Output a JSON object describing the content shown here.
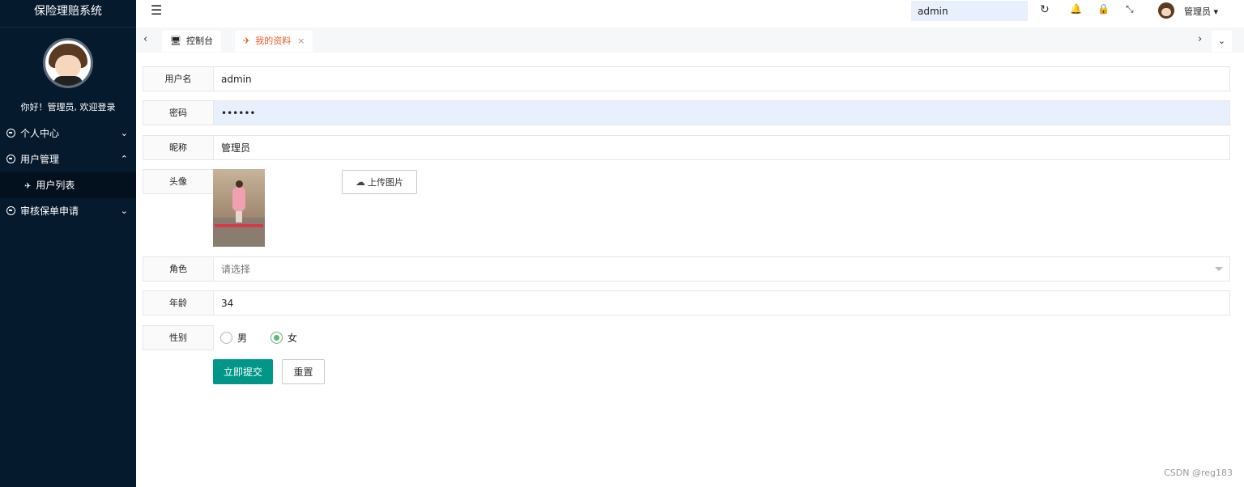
{
  "sidebar": {
    "title": "保险理赔系统",
    "welcome": "你好！管理员, 欢迎登录",
    "menu": [
      {
        "label": "个人中心",
        "chevron": "⌄"
      },
      {
        "label": "用户管理",
        "chevron": "⌃"
      },
      {
        "label": "审核保单申请",
        "chevron": "⌄"
      }
    ],
    "submenu": [
      {
        "label": "用户列表",
        "icon": "✈"
      }
    ]
  },
  "header": {
    "fold_icon": "☰",
    "search_value": "admin",
    "icons": {
      "refresh": "↻",
      "bell": "🔔",
      "lock": "🔒",
      "fullscreen": "⤡"
    },
    "user_name": "管理员 ▾"
  },
  "tabs": {
    "left_arrow": "‹",
    "right_arrow": "›",
    "dropdown": "⌄",
    "items": [
      {
        "label": "控制台",
        "icon": "🖥"
      },
      {
        "label": "我的资料",
        "icon": "✈",
        "close": "×",
        "active": true
      }
    ]
  },
  "form": {
    "username": {
      "label": "用户名",
      "value": "admin"
    },
    "password": {
      "label": "密码",
      "value": "••••••"
    },
    "nickname": {
      "label": "昵称",
      "value": "管理员"
    },
    "avatar": {
      "label": "头像",
      "upload_label": "上传图片",
      "upload_icon": "☁"
    },
    "role": {
      "label": "角色",
      "placeholder": "请选择"
    },
    "age": {
      "label": "年龄",
      "value": "34"
    },
    "gender": {
      "label": "性别",
      "options": [
        "男",
        "女"
      ],
      "selected": "女"
    },
    "submit_label": "立即提交",
    "reset_label": "重置"
  },
  "watermark": "CSDN @reg183",
  "colors": {
    "sidebar_bg": "#061a2e",
    "primary": "#009688",
    "active_tab": "#f05a28",
    "radio_checked": "#5fb878"
  }
}
